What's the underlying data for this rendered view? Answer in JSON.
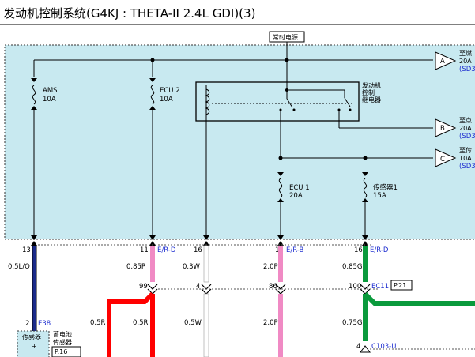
{
  "title": "发动机控制系统(G4KJ : THETA-II 2.4L GDI)(3)",
  "top_label": "常时电源",
  "fuses": [
    {
      "name": "AMS",
      "amp": "10A"
    },
    {
      "name": "ECU 2",
      "amp": "10A"
    },
    {
      "name": "ECU 1",
      "amp": "20A"
    },
    {
      "name": "传感器1",
      "amp": "15A"
    }
  ],
  "relay_label": [
    "发动机",
    "控制",
    "继电器"
  ],
  "connectors": [
    {
      "id": "A",
      "dest": "至燃",
      "amp": "20A",
      "ref": "(SD3"
    },
    {
      "id": "B",
      "dest": "至点",
      "amp": "20A",
      "ref": "(SD3"
    },
    {
      "id": "C",
      "dest": "至传",
      "amp": "10A",
      "ref": "(SD3"
    }
  ],
  "pins": [
    {
      "pin": "13",
      "conn": "",
      "wire": "0.5L/O"
    },
    {
      "pin": "11",
      "conn": "E/R-D",
      "wire": "0.85P"
    },
    {
      "pin": "16",
      "conn": "",
      "wire": "0.3W"
    },
    {
      "pin": "1",
      "conn": "E/R-B",
      "wire": "2.0P"
    },
    {
      "pin": "16",
      "conn": "E/R-D",
      "wire": "0.85G"
    }
  ],
  "lower": {
    "p99": "99",
    "p4": "4",
    "p86": "86",
    "p100": "100",
    "ec11": "EC11",
    "ec11_ref": "P.21",
    "w1": "0.5R",
    "w2": "0.5R",
    "w3": "0.5W",
    "w4": "2.0P",
    "w5": "0.75G",
    "pin2": "2",
    "e38": "E38",
    "sensor_box": "传感器",
    "sensor_plus": "+",
    "battery_label": [
      "蓄电池",
      "传感器"
    ],
    "battery_ref": "P.16",
    "pin4b": "4",
    "c103": "C103-U"
  },
  "colors": {
    "panel_bg": "#c8e9f0",
    "pink": "#f08ac4",
    "red": "#ff0000",
    "green": "#0a9a3c",
    "blue_wire": "#1a2a8a",
    "connector_text": "#1f2fd0"
  }
}
